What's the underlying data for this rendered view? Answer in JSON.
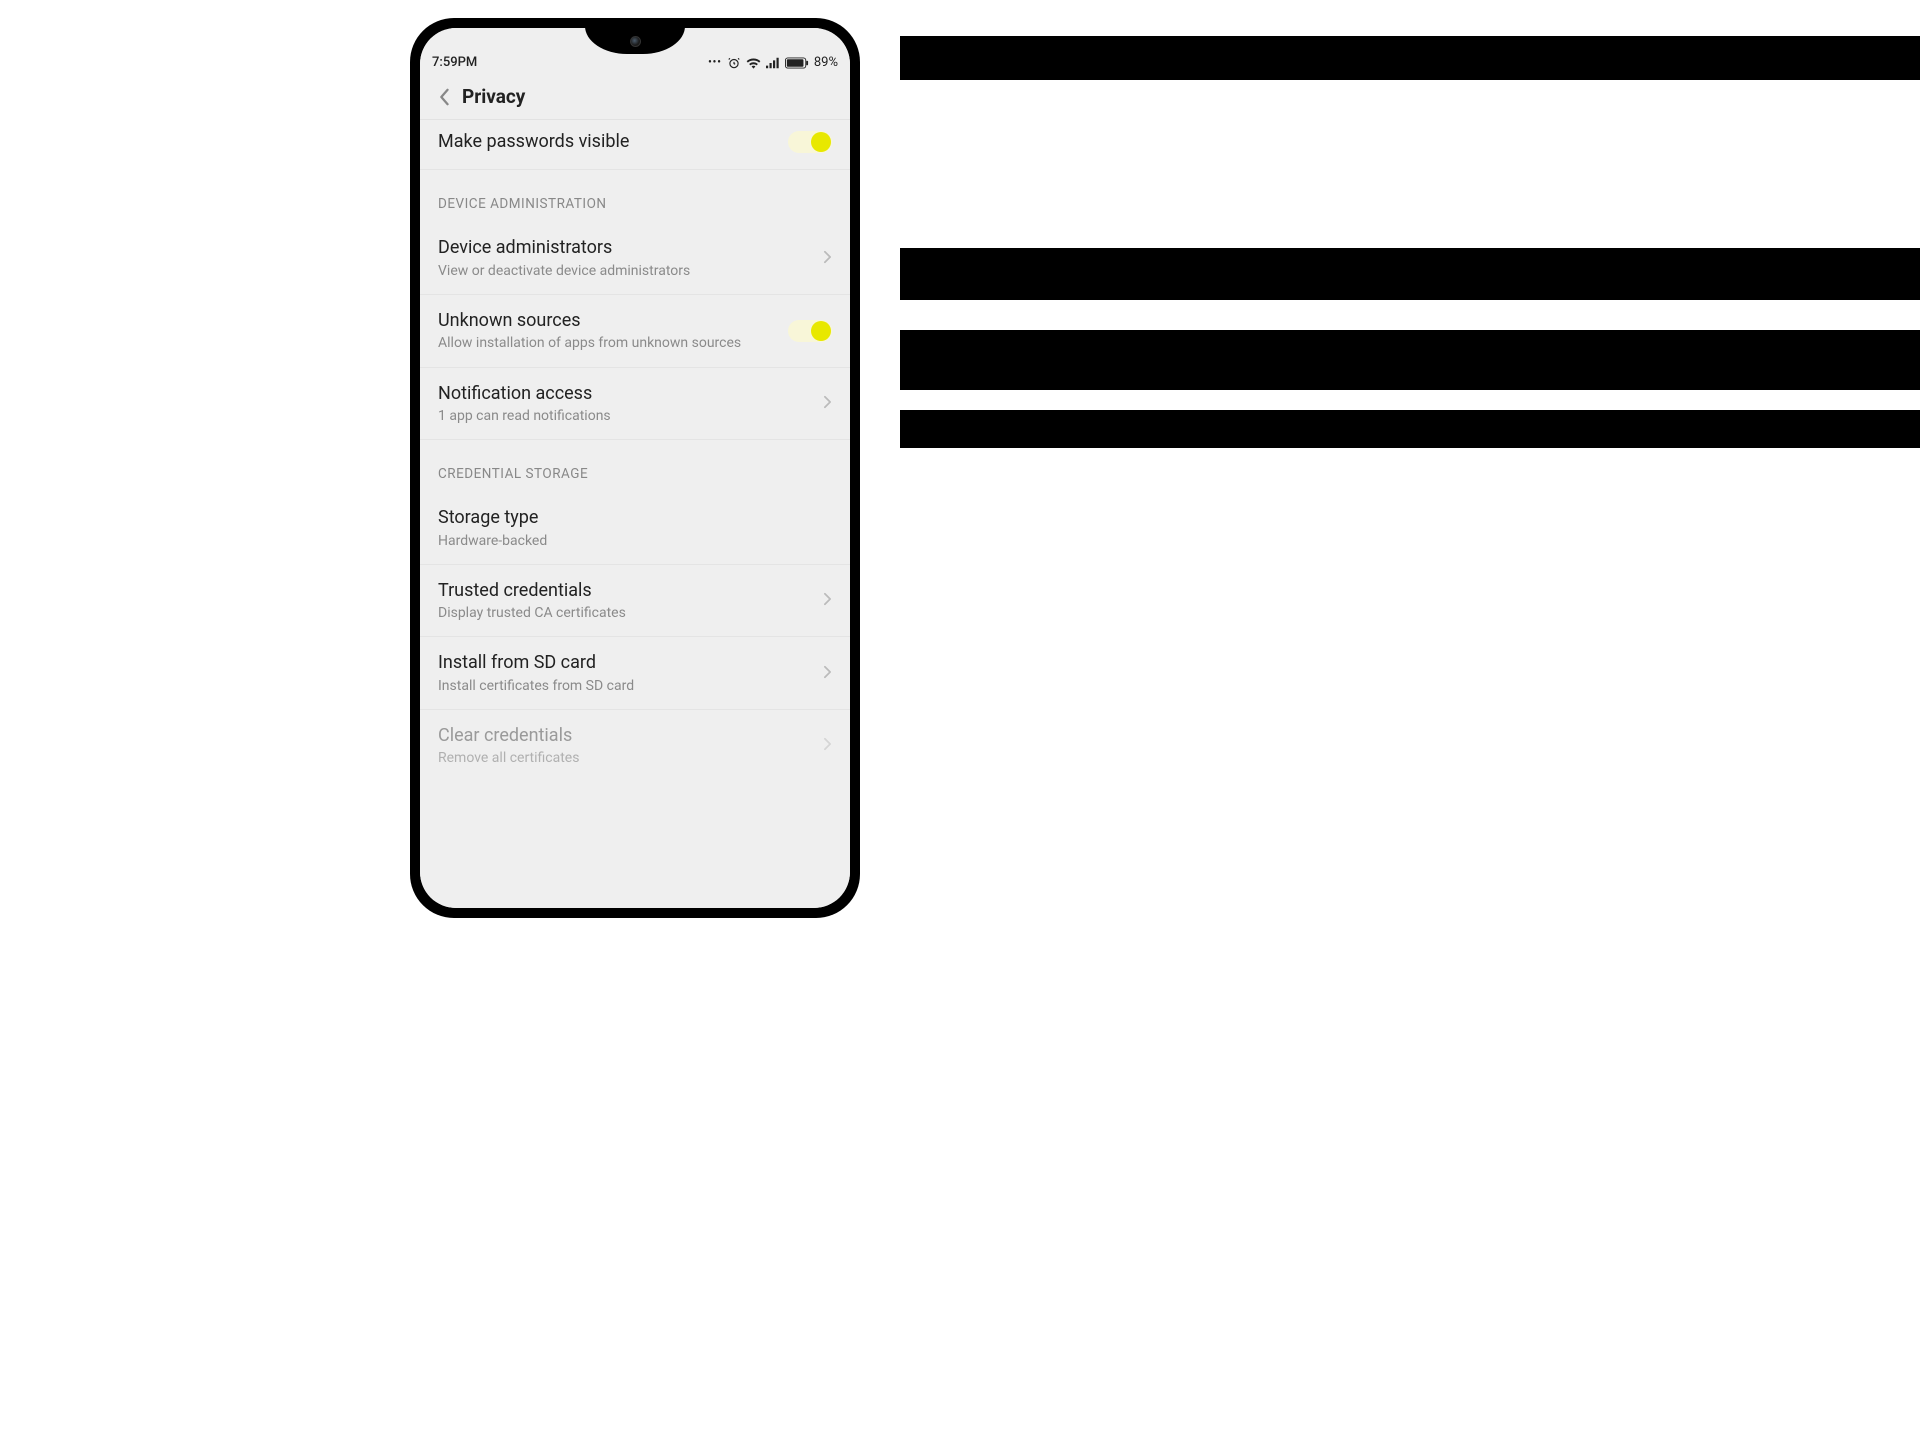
{
  "status_bar": {
    "time": "7:59PM",
    "battery_pct": "89%"
  },
  "header": {
    "title": "Privacy"
  },
  "items": {
    "passwords_visible": {
      "title": "Make passwords visible"
    }
  },
  "sections": {
    "device_admin": {
      "header": "DEVICE ADMINISTRATION",
      "items": {
        "device_admins": {
          "title": "Device administrators",
          "subtitle": "View or deactivate device administrators"
        },
        "unknown_sources": {
          "title": "Unknown sources",
          "subtitle": "Allow installation of apps from unknown sources"
        },
        "notification_access": {
          "title": "Notification access",
          "subtitle": "1 app can read notifications"
        }
      }
    },
    "credential_storage": {
      "header": "CREDENTIAL STORAGE",
      "items": {
        "storage_type": {
          "title": "Storage type",
          "subtitle": "Hardware-backed"
        },
        "trusted_credentials": {
          "title": "Trusted credentials",
          "subtitle": "Display trusted CA certificates"
        },
        "install_sd": {
          "title": "Install from SD card",
          "subtitle": "Install certificates from SD card"
        },
        "clear_credentials": {
          "title": "Clear credentials",
          "subtitle": "Remove all certificates"
        }
      }
    }
  }
}
